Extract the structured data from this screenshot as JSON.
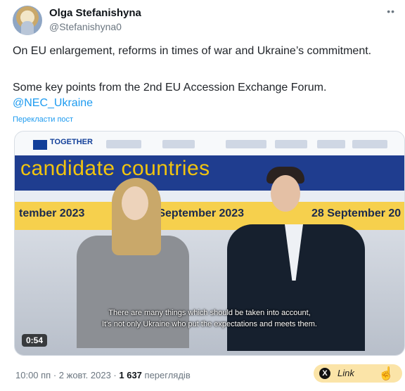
{
  "author": {
    "name": "Olga Stefanishyna",
    "handle": "@Stefanishyna0",
    "more": "••"
  },
  "tweet": {
    "line1": "On EU enlargement, reforms in times of war and Ukraine’s commitment.",
    "line2": "Some key points from the 2nd EU Accession Exchange Forum.",
    "mention": "@NEC_Ukraine",
    "translate": "Перекласти пост"
  },
  "video": {
    "banner_title": "candidate countries",
    "dates": [
      "tember 2023",
      "8 September 2023",
      "28 September 20"
    ],
    "logo_text": "TOGETHER",
    "subtitle_1": "There are many things which should be taken into account,",
    "subtitle_2": "It's not only Ukraine who put the expectations and meets them.",
    "duration": "0:54"
  },
  "meta": {
    "time": "10:00 пп · 2 жовт. 2023 · ",
    "views_count": "1 637",
    "views_label": " переглядів"
  },
  "link_chip": {
    "label": "Link",
    "x_icon": "X"
  },
  "colors": {
    "accent": "#1d9bf0",
    "banner": "#1f3d8f",
    "banner_text": "#f1c40f",
    "date_band": "#f6d04d",
    "chip": "#fbe4a8"
  }
}
